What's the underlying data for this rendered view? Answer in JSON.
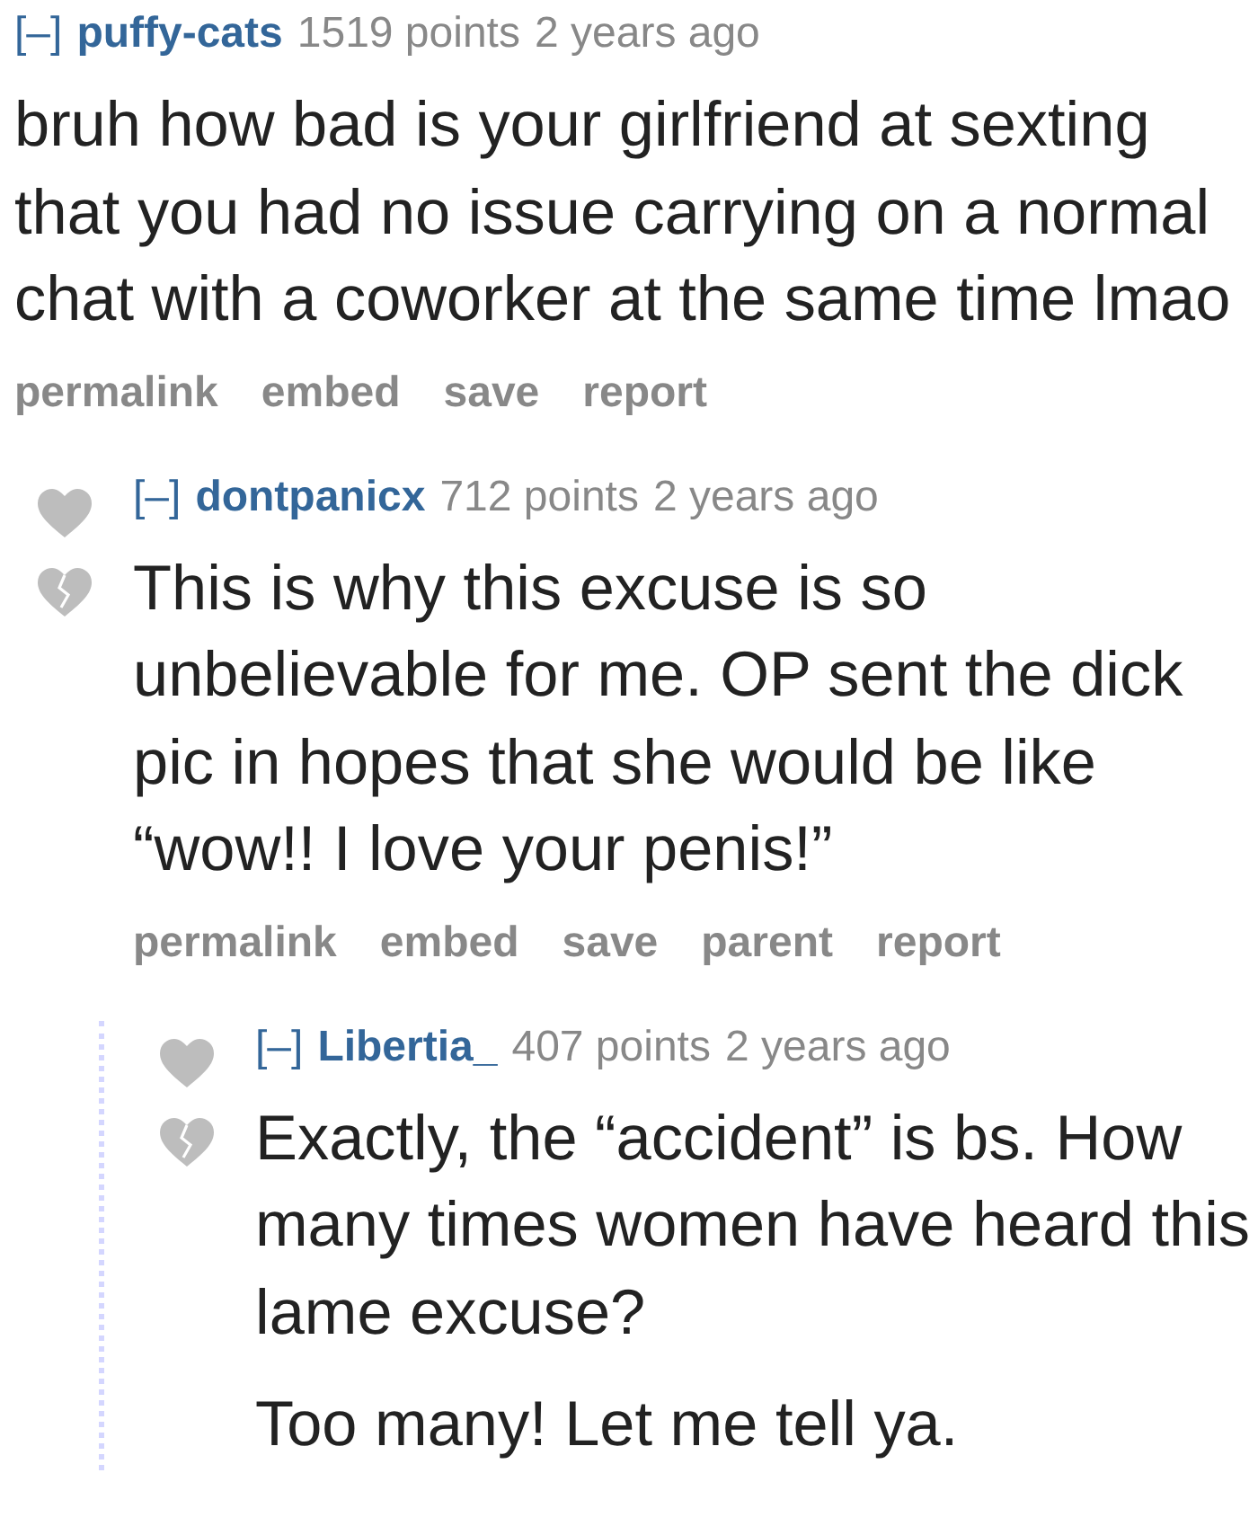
{
  "comments": [
    {
      "toggle": "[–]",
      "author": "puffy-cats",
      "score": "1519 points",
      "time": "2 years ago",
      "show_votes": false,
      "paragraphs": [
        "bruh how bad is your girlfriend at sexting that you had no issue carrying on a normal chat with a coworker at the same time lmao"
      ],
      "actions": [
        "permalink",
        "embed",
        "save",
        "report"
      ],
      "children": [
        {
          "toggle": "[–]",
          "author": "dontpanicx",
          "score": "712 points",
          "time": "2 years ago",
          "show_votes": true,
          "thread_line": true,
          "paragraphs": [
            "This is why this excuse is so unbelievable for me. OP sent the dick pic in hopes that she would be like “wow!! I love your penis!”"
          ],
          "actions": [
            "permalink",
            "embed",
            "save",
            "parent",
            "report"
          ],
          "children": [
            {
              "toggle": "[–]",
              "author": "Libertia_",
              "score": "407 points",
              "time": "2 years ago",
              "show_votes": true,
              "paragraphs": [
                "Exactly, the “accident” is bs. How many times women have heard this lame excuse?",
                "Too many! Let me tell ya."
              ]
            }
          ]
        }
      ]
    }
  ]
}
